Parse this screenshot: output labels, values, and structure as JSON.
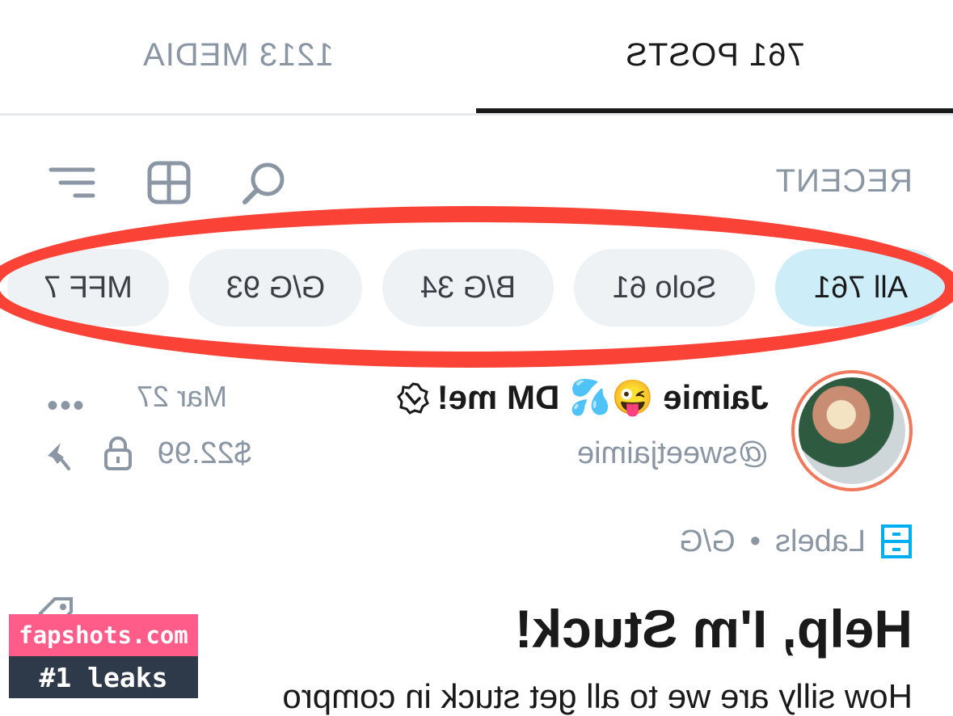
{
  "tabs": {
    "posts_label": "761 POSTS",
    "media_label": "1213 MEDIA"
  },
  "toolbar": {
    "sort_label": "RECENT",
    "icons": [
      "search-icon",
      "grid-icon",
      "filter-icon"
    ]
  },
  "chips": [
    {
      "label": "All 761",
      "active": true
    },
    {
      "label": "Solo 61",
      "active": false
    },
    {
      "label": "B/G 34",
      "active": false
    },
    {
      "label": "G/G 93",
      "active": false
    },
    {
      "label": "MFF 7",
      "active": false
    }
  ],
  "post": {
    "author_name": "Jaimie 😜💦 DM me!",
    "handle": "@sweetjaimie",
    "date": "Mar 27",
    "price": "$22.99",
    "labels_prefix": "Labels",
    "label_value": "G/G",
    "title": "Help, I'm Stuck!",
    "text": "How silly are we to all get stuck in compro"
  },
  "watermark": {
    "top": "fapshots.com",
    "bottom": "#1 leaks"
  },
  "colors": {
    "accent_blue": "#00aff0",
    "chip_active": "#cdeef9",
    "highlight_red": "#fa4237",
    "muted": "#8a96a3"
  }
}
